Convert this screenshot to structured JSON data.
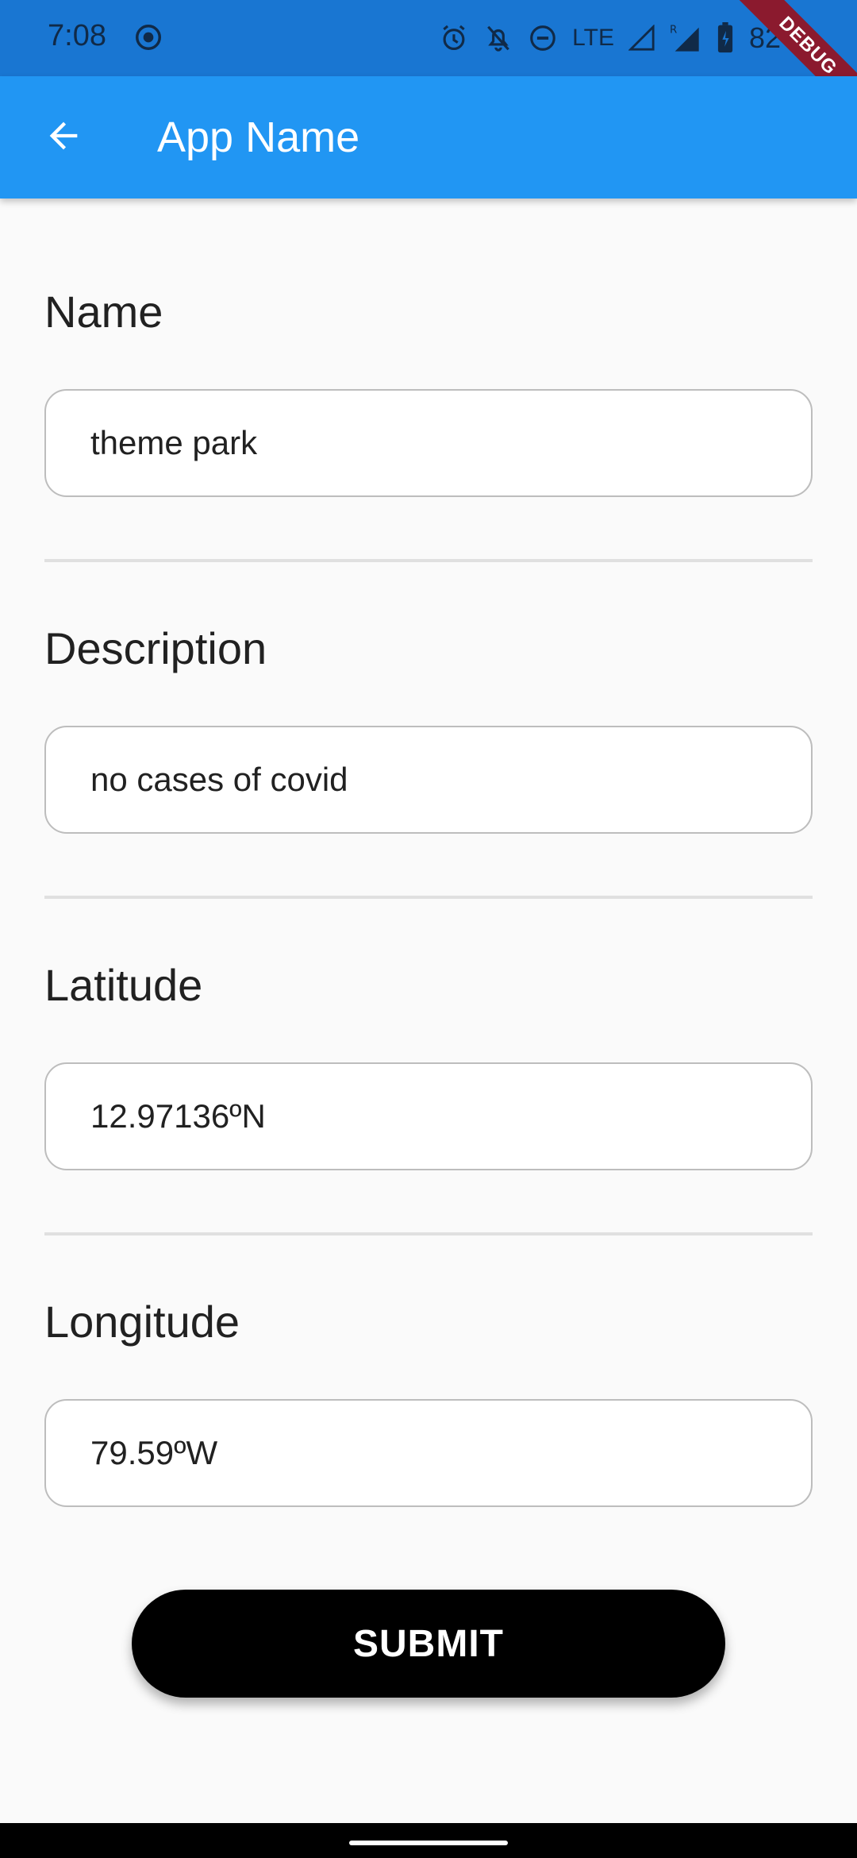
{
  "status_bar": {
    "time": "7:08",
    "network": "LTE",
    "battery": "82",
    "icons": [
      "screen-record-icon",
      "alarm-icon",
      "notifications-off-icon",
      "do-not-disturb-icon",
      "signal-icon",
      "roaming-signal-icon",
      "battery-icon"
    ]
  },
  "debug_banner": "DEBUG",
  "app_bar": {
    "title": "App Name",
    "back_icon": "arrow-back-icon"
  },
  "form": {
    "fields": [
      {
        "label": "Name",
        "value": "theme park"
      },
      {
        "label": "Description",
        "value": "no cases of covid"
      },
      {
        "label": "Latitude",
        "value": "12.97136ºN"
      },
      {
        "label": "Longitude",
        "value": "79.59ºW"
      }
    ],
    "submit_label": "SUBMIT"
  },
  "colors": {
    "app_bar": "#2196f3",
    "status_bar": "#1976d2",
    "button": "#000000",
    "debug_banner": "#8b1a2e"
  }
}
